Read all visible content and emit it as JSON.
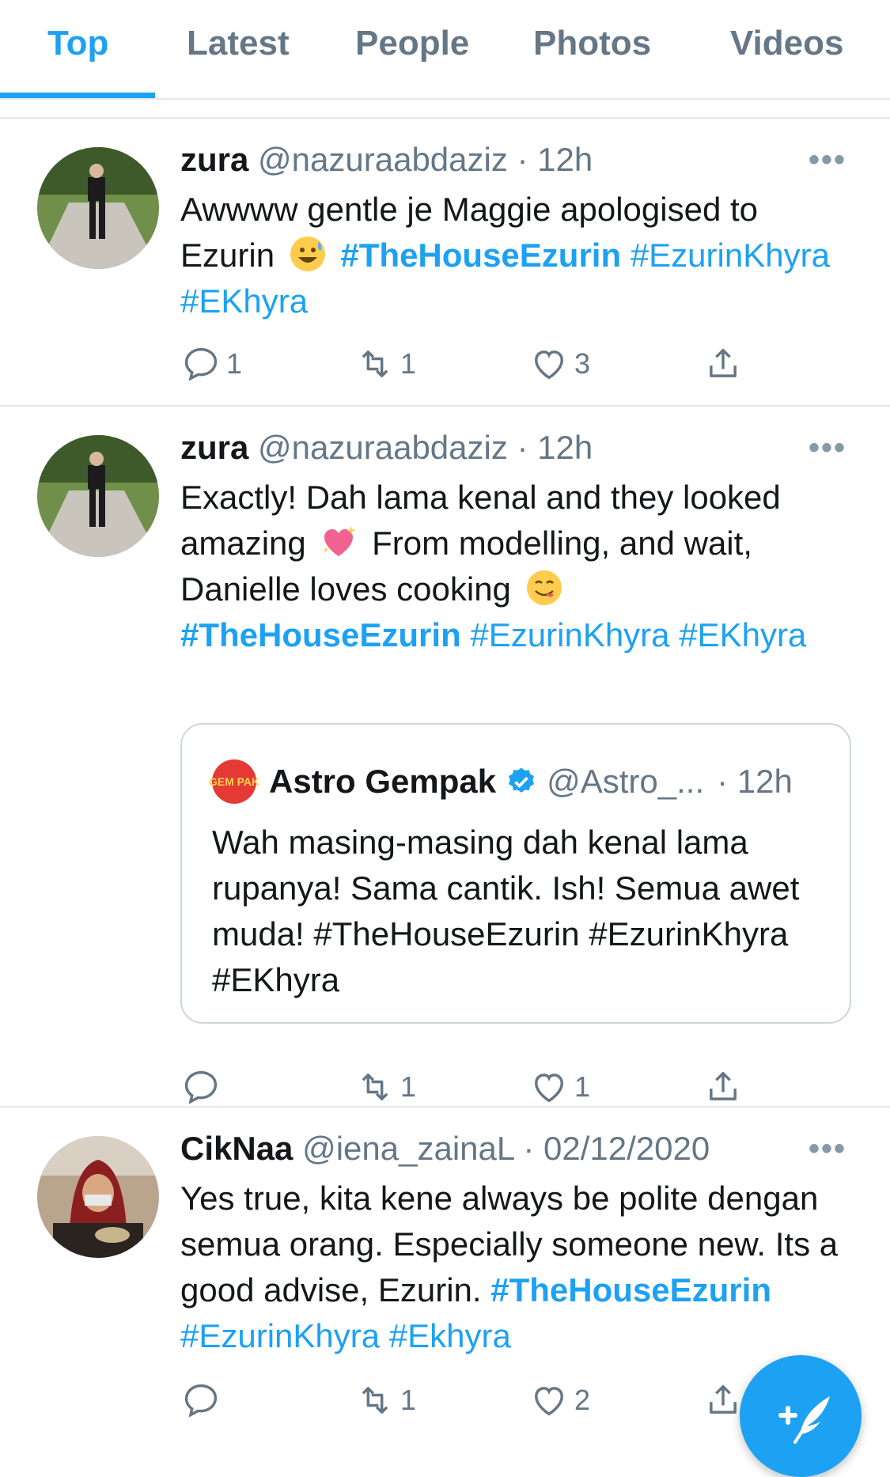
{
  "tabs": [
    {
      "label": "Top",
      "active": true
    },
    {
      "label": "Latest"
    },
    {
      "label": "People"
    },
    {
      "label": "Photos"
    },
    {
      "label": "Videos"
    }
  ],
  "colors": {
    "accent": "#1da1f2",
    "secondary_text": "#657786",
    "divider": "#e1e8ed"
  },
  "tweets": [
    {
      "name": "zura",
      "handle": "@nazuraabdaziz",
      "time": "· 12h",
      "more": "•••",
      "text_1": "Awwww gentle je Maggie apologised to Ezurin",
      "emoji_1": "grinning-sweat-emoji",
      "hashtags": [
        "#TheHouseEzurin",
        "#EzurinKhyra",
        "#EKhyra"
      ],
      "replies": "1",
      "retweets": "1",
      "likes": "3"
    },
    {
      "name": "zura",
      "handle": "@nazuraabdaziz",
      "time": "· 12h",
      "more": "•••",
      "text_1": "Exactly! Dah lama kenal and they looked amazing",
      "emoji_1": "sparkling-heart-emoji",
      "text_2": "From modelling, and wait, Danielle loves cooking",
      "emoji_2": "yum-face-emoji",
      "hashtags": [
        "#TheHouseEzurin",
        "#EzurinKhyra",
        "#EKhyra"
      ],
      "quote": {
        "logo_text": "GEM PAK",
        "name": "Astro Gempak",
        "handle": "@Astro_...",
        "time": "· 12h",
        "text": "Wah masing-masing dah kenal lama rupanya! Sama cantik. Ish! Semua awet muda! #TheHouseEzurin #EzurinKhyra #EKhyra"
      },
      "replies": "",
      "retweets": "1",
      "likes": "1"
    },
    {
      "name": "CikNaa",
      "handle": "@iena_zainaL",
      "time": "· 02/12/2020",
      "more": "•••",
      "text_1": "Yes true, kita kene always be polite dengan semua orang. Especially someone new. Its a good advise, Ezurin.",
      "hashtags": [
        "#TheHouseEzurin",
        "#EzurinKhyra",
        "#Ekhyra"
      ],
      "replies": "",
      "retweets": "1",
      "likes": "2"
    }
  ]
}
